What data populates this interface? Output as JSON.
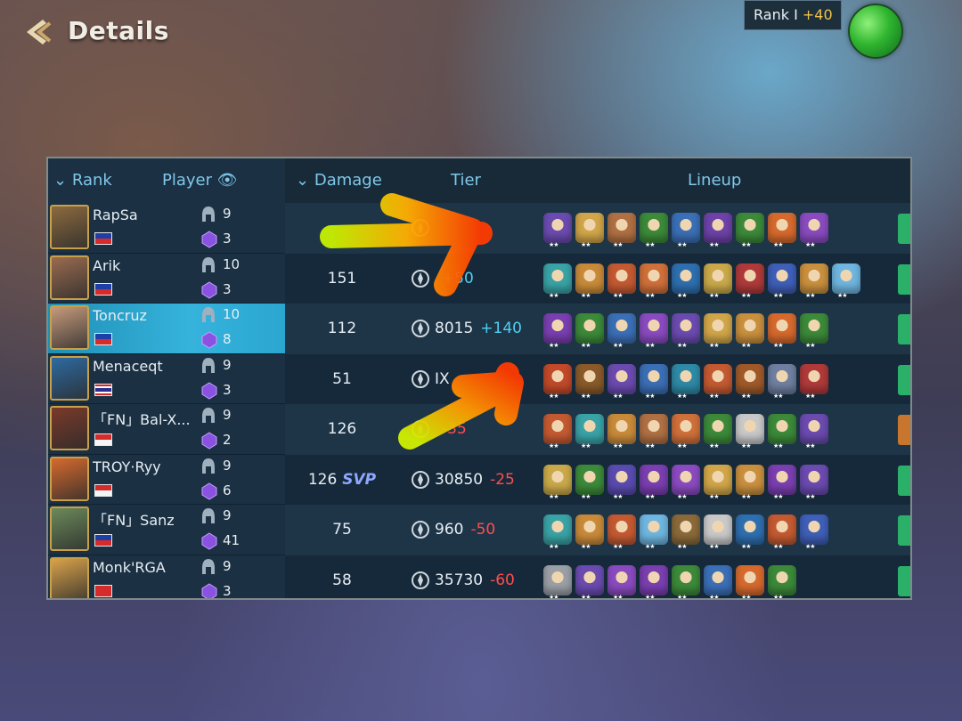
{
  "header": {
    "title": "Details",
    "rank_label": "Rank I",
    "rank_delta": "+40"
  },
  "table": {
    "columns": {
      "rank": "Rank",
      "player": "Player",
      "damage": "Damage",
      "tier": "Tier",
      "lineup": "Lineup"
    },
    "rows": [
      {
        "player": "RapSa",
        "flag": "ph",
        "level": "9",
        "gems": "3",
        "damage": "",
        "svp": "",
        "tier": "",
        "delta": "",
        "delta_sign": "",
        "avatar_color": "#8c6a3f",
        "units": [
          "#6b4bb0",
          "#d1a64a",
          "#b07043",
          "#3c8a3a",
          "#3b6fb6",
          "#6e42a8",
          "#3c8a3a",
          "#d66a2e",
          "#8a4bc0"
        ],
        "btn": "green"
      },
      {
        "player": "Arik",
        "flag": "ph",
        "level": "10",
        "gems": "3",
        "damage": "151",
        "svp": "",
        "tier": "",
        "delta": "+50",
        "delta_sign": "pos",
        "avatar_color": "#9a6b50",
        "units": [
          "#3aa3a6",
          "#c98b3a",
          "#c45a32",
          "#d0703a",
          "#2e6fb0",
          "#c9a94a",
          "#b03a3a",
          "#3f5fb8",
          "#c9903e",
          "#6fb6e0"
        ],
        "btn": "green"
      },
      {
        "player": "Toncruz",
        "flag": "ph",
        "level": "10",
        "gems": "8",
        "damage": "112",
        "svp": "",
        "tier": "8015",
        "delta": "+140",
        "delta_sign": "pos",
        "avatar_color": "#c59a7b",
        "units": [
          "#7a3fb0",
          "#3c8a3a",
          "#3b6fb6",
          "#8a4bc0",
          "#6b4bb0",
          "#d1a64a",
          "#c9903e",
          "#d66a2e",
          "#3c8a3a"
        ],
        "btn": "green",
        "highlight": true
      },
      {
        "player": "Menaceqt",
        "flag": "th",
        "level": "9",
        "gems": "3",
        "damage": "51",
        "svp": "",
        "tier": "IX",
        "delta": "",
        "delta_sign": "",
        "avatar_color": "#2e6aa0",
        "units": [
          "#c24a2a",
          "#8a5a2a",
          "#6b4bb0",
          "#3b6fb6",
          "#2e8aa6",
          "#c45a32",
          "#a05a2a",
          "#6f7fa0",
          "#b03a3a"
        ],
        "btn": "green"
      },
      {
        "player": "「FN」Bal-X...",
        "flag": "id",
        "level": "9",
        "gems": "2",
        "damage": "126",
        "svp": "",
        "tier": "",
        "delta": "-35",
        "delta_sign": "neg",
        "avatar_color": "#7a3a2a",
        "units": [
          "#c45a32",
          "#3aa3a6",
          "#c98b3a",
          "#b07043",
          "#d0703a",
          "#3c8a3a",
          "#c9c9c9",
          "#3c8a3a",
          "#6b4bb0"
        ],
        "btn": "gold"
      },
      {
        "player": "TROY·Ryy",
        "flag": "id",
        "level": "9",
        "gems": "6",
        "damage": "126",
        "svp": "SVP",
        "tier": "30850",
        "delta": "-25",
        "delta_sign": "neg",
        "avatar_color": "#d66a2e",
        "units": [
          "#c9a94a",
          "#3c8a3a",
          "#5a4bb0",
          "#7a3fb0",
          "#8a4bc0",
          "#d1a64a",
          "#c9903e",
          "#7a3fb0",
          "#6b4bb0"
        ],
        "btn": "green"
      },
      {
        "player": "「FN」Sanz",
        "flag": "ph",
        "level": "9",
        "gems": "41",
        "damage": "75",
        "svp": "",
        "tier": "960",
        "delta": "-50",
        "delta_sign": "neg",
        "avatar_color": "#6b8a5a",
        "units": [
          "#3aa3a6",
          "#c98b3a",
          "#c45a32",
          "#6fb6e0",
          "#8a6a3a",
          "#c9c9c9",
          "#2e6fb0",
          "#c45a32",
          "#3f5fb8"
        ],
        "btn": "green"
      },
      {
        "player": "Monk'RGA",
        "flag": "hk",
        "level": "9",
        "gems": "3",
        "damage": "58",
        "svp": "",
        "tier": "35730",
        "delta": "-60",
        "delta_sign": "neg",
        "avatar_color": "#d9a24a",
        "units": [
          "#9aa0a6",
          "#6b4bb0",
          "#8a4bc0",
          "#7a3fb0",
          "#3c8a3a",
          "#3b6fb6",
          "#d66a2e",
          "#3c8a3a"
        ],
        "btn": "green"
      }
    ]
  },
  "colors": {
    "panel_bg": "#182a38",
    "header_text": "#7fc8ea",
    "highlight": "#2aa6d0",
    "negative": "#ff4d4d",
    "positive": "#4fd0f0"
  },
  "icons": [
    "back-chevron-icon",
    "eye-icon",
    "sort-down-icon",
    "helmet-icon",
    "gem-icon",
    "tier-crest-icon",
    "mode-icon"
  ]
}
